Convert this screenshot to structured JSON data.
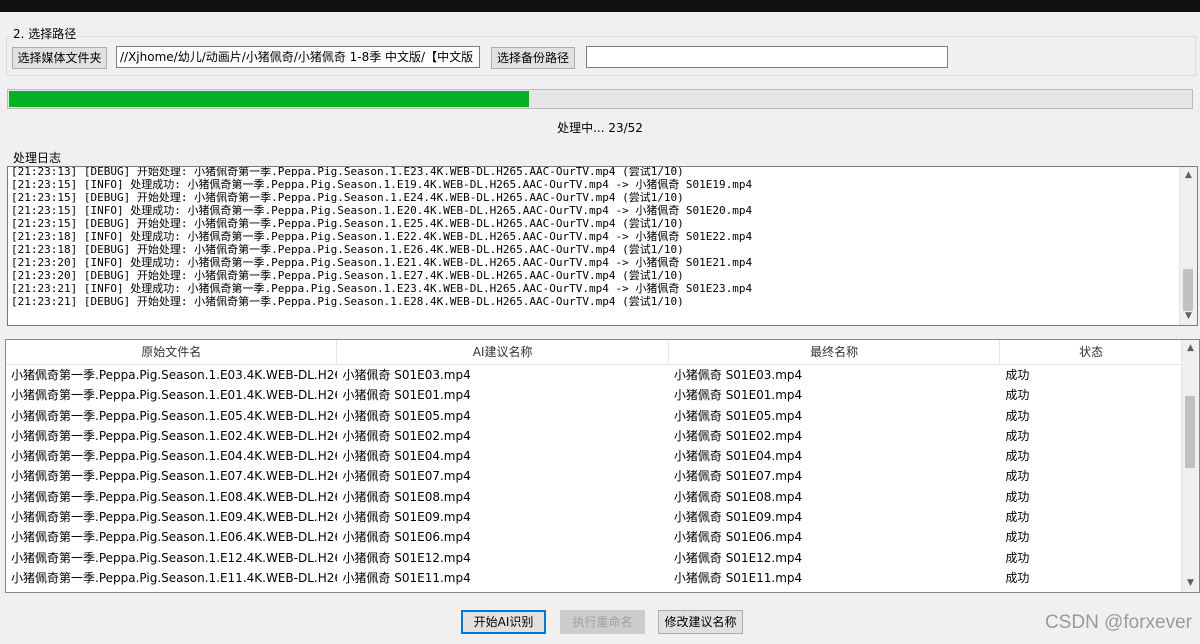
{
  "path_section": {
    "title": "2. 选择路径",
    "select_media_button": "选择媒体文件夹",
    "media_path_value": "//Xjhome/幼儿/动画片/小猪佩奇/小猪佩奇 1-8季 中文版/【中文版",
    "select_backup_button": "选择备份路径",
    "backup_path_value": ""
  },
  "progress": {
    "fraction": 0.44,
    "status_text": "处理中... 23/52",
    "color": "#06b025"
  },
  "log": {
    "title": "处理日志",
    "lines": [
      "[21:23:13] [DEBUG] 开始处理: 小猪佩奇第一季.Peppa.Pig.Season.1.E23.4K.WEB-DL.H265.AAC-OurTV.mp4 (尝试1/10)",
      "[21:23:15] [INFO] 处理成功: 小猪佩奇第一季.Peppa.Pig.Season.1.E19.4K.WEB-DL.H265.AAC-OurTV.mp4 -> 小猪佩奇 S01E19.mp4",
      "[21:23:15] [DEBUG] 开始处理: 小猪佩奇第一季.Peppa.Pig.Season.1.E24.4K.WEB-DL.H265.AAC-OurTV.mp4 (尝试1/10)",
      "[21:23:15] [INFO] 处理成功: 小猪佩奇第一季.Peppa.Pig.Season.1.E20.4K.WEB-DL.H265.AAC-OurTV.mp4 -> 小猪佩奇 S01E20.mp4",
      "[21:23:15] [DEBUG] 开始处理: 小猪佩奇第一季.Peppa.Pig.Season.1.E25.4K.WEB-DL.H265.AAC-OurTV.mp4 (尝试1/10)",
      "[21:23:18] [INFO] 处理成功: 小猪佩奇第一季.Peppa.Pig.Season.1.E22.4K.WEB-DL.H265.AAC-OurTV.mp4 -> 小猪佩奇 S01E22.mp4",
      "[21:23:18] [DEBUG] 开始处理: 小猪佩奇第一季.Peppa.Pig.Season.1.E26.4K.WEB-DL.H265.AAC-OurTV.mp4 (尝试1/10)",
      "[21:23:20] [INFO] 处理成功: 小猪佩奇第一季.Peppa.Pig.Season.1.E21.4K.WEB-DL.H265.AAC-OurTV.mp4 -> 小猪佩奇 S01E21.mp4",
      "[21:23:20] [DEBUG] 开始处理: 小猪佩奇第一季.Peppa.Pig.Season.1.E27.4K.WEB-DL.H265.AAC-OurTV.mp4 (尝试1/10)",
      "[21:23:21] [INFO] 处理成功: 小猪佩奇第一季.Peppa.Pig.Season.1.E23.4K.WEB-DL.H265.AAC-OurTV.mp4 -> 小猪佩奇 S01E23.mp4",
      "[21:23:21] [DEBUG] 开始处理: 小猪佩奇第一季.Peppa.Pig.Season.1.E28.4K.WEB-DL.H265.AAC-OurTV.mp4 (尝试1/10)"
    ]
  },
  "table": {
    "columns": [
      "原始文件名",
      "AI建议名称",
      "最终名称",
      "状态"
    ],
    "rows": [
      [
        "小猪佩奇第一季.Peppa.Pig.Season.1.E03.4K.WEB-DL.H26",
        "小猪佩奇 S01E03.mp4",
        "小猪佩奇 S01E03.mp4",
        "成功"
      ],
      [
        "小猪佩奇第一季.Peppa.Pig.Season.1.E01.4K.WEB-DL.H26",
        "小猪佩奇 S01E01.mp4",
        "小猪佩奇 S01E01.mp4",
        "成功"
      ],
      [
        "小猪佩奇第一季.Peppa.Pig.Season.1.E05.4K.WEB-DL.H26",
        "小猪佩奇 S01E05.mp4",
        "小猪佩奇 S01E05.mp4",
        "成功"
      ],
      [
        "小猪佩奇第一季.Peppa.Pig.Season.1.E02.4K.WEB-DL.H26",
        "小猪佩奇 S01E02.mp4",
        "小猪佩奇 S01E02.mp4",
        "成功"
      ],
      [
        "小猪佩奇第一季.Peppa.Pig.Season.1.E04.4K.WEB-DL.H26",
        "小猪佩奇 S01E04.mp4",
        "小猪佩奇 S01E04.mp4",
        "成功"
      ],
      [
        "小猪佩奇第一季.Peppa.Pig.Season.1.E07.4K.WEB-DL.H26",
        "小猪佩奇 S01E07.mp4",
        "小猪佩奇 S01E07.mp4",
        "成功"
      ],
      [
        "小猪佩奇第一季.Peppa.Pig.Season.1.E08.4K.WEB-DL.H26",
        "小猪佩奇 S01E08.mp4",
        "小猪佩奇 S01E08.mp4",
        "成功"
      ],
      [
        "小猪佩奇第一季.Peppa.Pig.Season.1.E09.4K.WEB-DL.H26",
        "小猪佩奇 S01E09.mp4",
        "小猪佩奇 S01E09.mp4",
        "成功"
      ],
      [
        "小猪佩奇第一季.Peppa.Pig.Season.1.E06.4K.WEB-DL.H26",
        "小猪佩奇 S01E06.mp4",
        "小猪佩奇 S01E06.mp4",
        "成功"
      ],
      [
        "小猪佩奇第一季.Peppa.Pig.Season.1.E12.4K.WEB-DL.H26",
        "小猪佩奇 S01E12.mp4",
        "小猪佩奇 S01E12.mp4",
        "成功"
      ],
      [
        "小猪佩奇第一季.Peppa.Pig.Season.1.E11.4K.WEB-DL.H26",
        "小猪佩奇 S01E11.mp4",
        "小猪佩奇 S01E11.mp4",
        "成功"
      ]
    ]
  },
  "actions": {
    "start_ai_button": "开始AI识别",
    "rename_button": "执行重命名",
    "edit_suggestion_button": "修改建议名称"
  },
  "watermark": "CSDN @forxever",
  "icons": {
    "scroll_up": "chevron-up-icon",
    "scroll_down": "chevron-down-icon"
  }
}
